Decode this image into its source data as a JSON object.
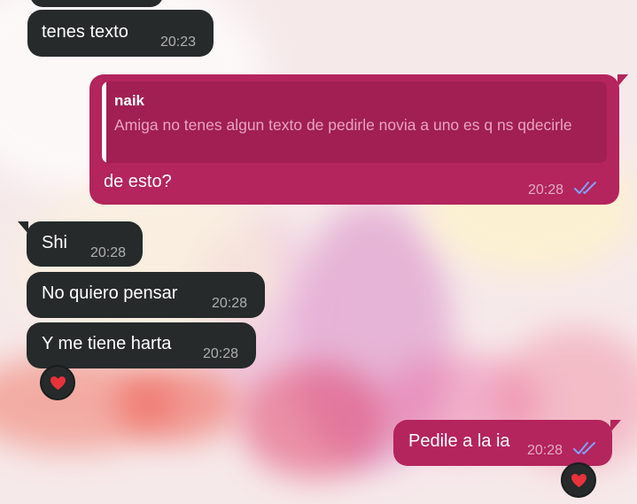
{
  "chat": {
    "messages": [
      {
        "id": "m1",
        "direction": "incoming",
        "text": "tenes texto",
        "time": "20:23"
      },
      {
        "id": "m2",
        "direction": "outgoing",
        "reply_to": {
          "name": "naik",
          "text": "Amiga no tenes algun texto de pedirle novia a uno es q ns qdecirle"
        },
        "text": "de esto?",
        "time": "20:28",
        "status_icon": "double-check-icon"
      },
      {
        "id": "m3",
        "direction": "incoming",
        "text": "Shi",
        "time": "20:28"
      },
      {
        "id": "m4",
        "direction": "incoming",
        "text": "No quiero pensar",
        "time": "20:28"
      },
      {
        "id": "m5",
        "direction": "incoming",
        "text": "Y me tiene harta",
        "time": "20:28",
        "reaction": "heart-icon"
      },
      {
        "id": "m6",
        "direction": "outgoing",
        "text": "Pedile a la ia",
        "time": "20:28",
        "status_icon": "double-check-icon",
        "reaction": "heart-icon"
      }
    ]
  },
  "colors": {
    "incoming_bubble": "#262a2b",
    "outgoing_bubble": "#b4245d",
    "quote_background": "#a11f52",
    "read_ticks": "#7ea2ff",
    "heart": "#e8323c"
  }
}
